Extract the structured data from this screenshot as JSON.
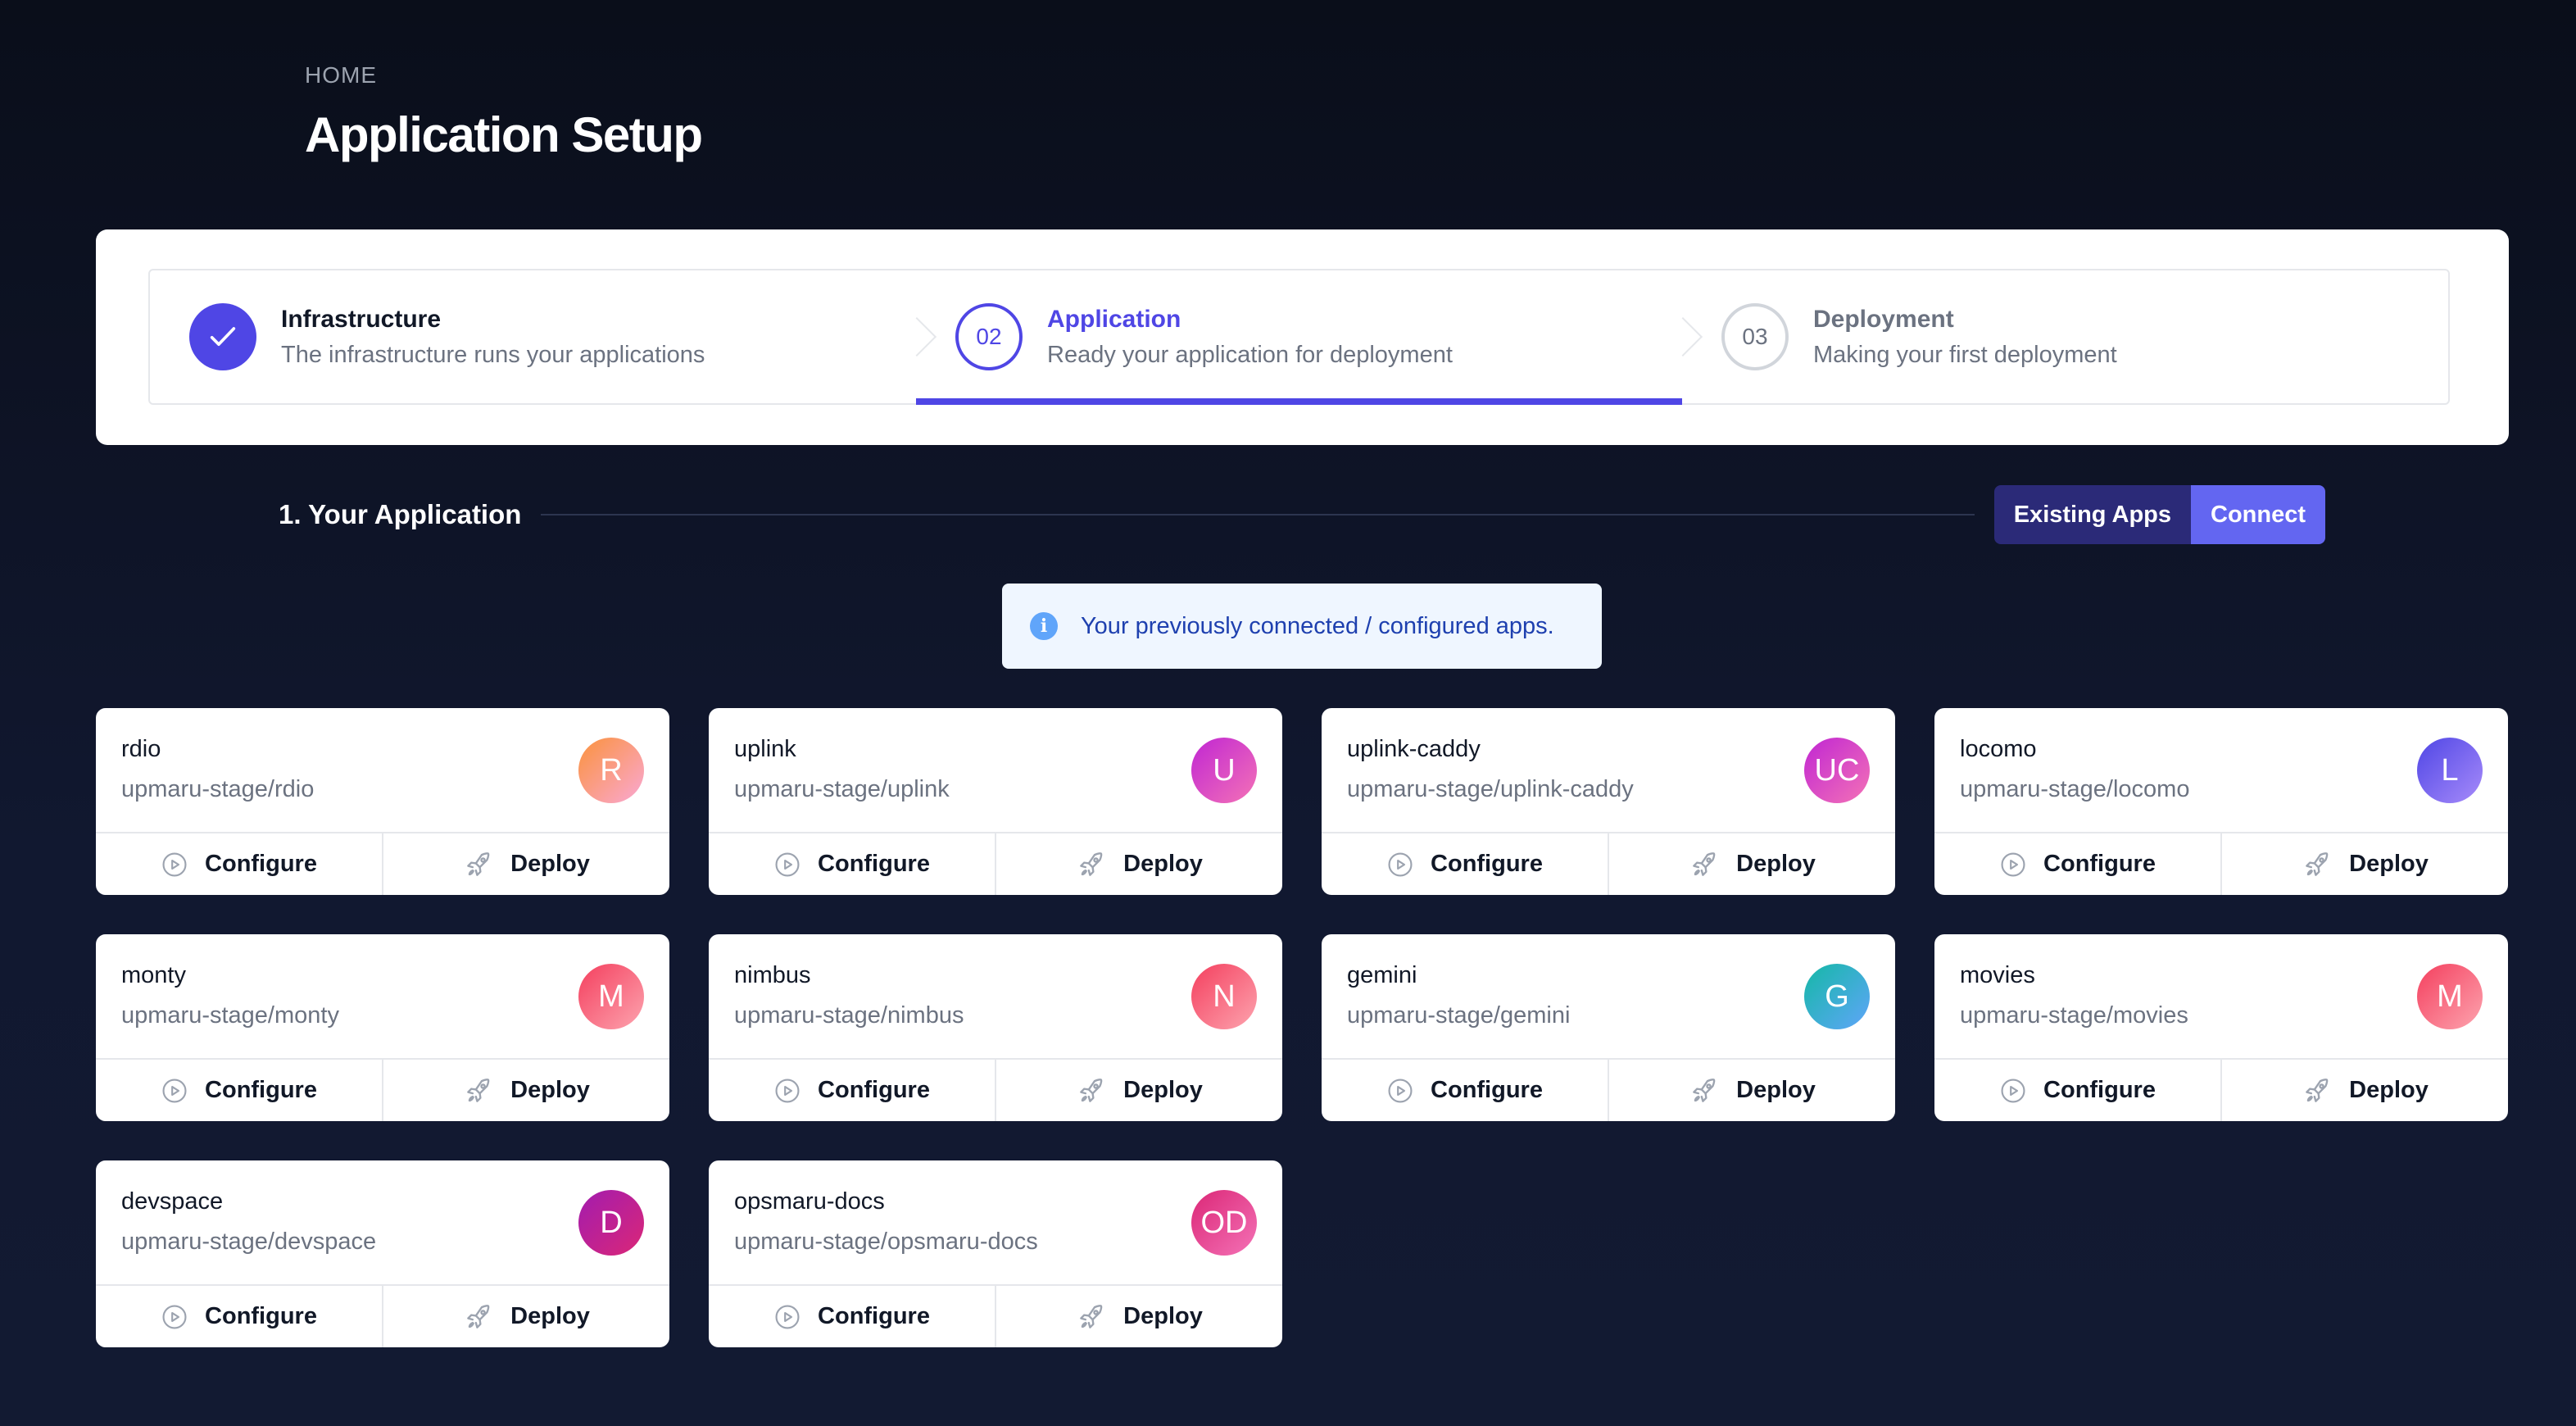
{
  "header": {
    "breadcrumb": "HOME",
    "title": "Application Setup"
  },
  "steps": [
    {
      "number": "",
      "title": "Infrastructure",
      "description": "The infrastructure runs your applications",
      "state": "complete",
      "icon": "check-icon"
    },
    {
      "number": "02",
      "title": "Application",
      "description": "Ready your application for deployment",
      "state": "current"
    },
    {
      "number": "03",
      "title": "Deployment",
      "description": "Making your first deployment",
      "state": "upcoming"
    }
  ],
  "section": {
    "title": "1. Your Application",
    "existing_label": "Existing Apps",
    "connect_label": "Connect"
  },
  "info": {
    "icon": "info-icon",
    "text": "Your previously connected / configured apps."
  },
  "actions": {
    "configure_label": "Configure",
    "deploy_label": "Deploy",
    "configure_icon": "play-circle-icon",
    "deploy_icon": "rocket-icon"
  },
  "apps": [
    {
      "name": "rdio",
      "repo": "upmaru-stage/rdio",
      "initials": "R",
      "gradient": [
        "#fb923c",
        "#f9a8d4"
      ]
    },
    {
      "name": "uplink",
      "repo": "upmaru-stage/uplink",
      "initials": "U",
      "gradient": [
        "#c026d3",
        "#f472b6"
      ]
    },
    {
      "name": "uplink-caddy",
      "repo": "upmaru-stage/uplink-caddy",
      "initials": "UC",
      "gradient": [
        "#c026d3",
        "#f472b6"
      ]
    },
    {
      "name": "locomo",
      "repo": "upmaru-stage/locomo",
      "initials": "L",
      "gradient": [
        "#4f46e5",
        "#a78bfa"
      ]
    },
    {
      "name": "monty",
      "repo": "upmaru-stage/monty",
      "initials": "M",
      "gradient": [
        "#f43f5e",
        "#fda4af"
      ]
    },
    {
      "name": "nimbus",
      "repo": "upmaru-stage/nimbus",
      "initials": "N",
      "gradient": [
        "#f43f5e",
        "#fda4af"
      ]
    },
    {
      "name": "gemini",
      "repo": "upmaru-stage/gemini",
      "initials": "G",
      "gradient": [
        "#14b8a6",
        "#60a5fa"
      ]
    },
    {
      "name": "movies",
      "repo": "upmaru-stage/movies",
      "initials": "M",
      "gradient": [
        "#f43f5e",
        "#fda4af"
      ]
    },
    {
      "name": "devspace",
      "repo": "upmaru-stage/devspace",
      "initials": "D",
      "gradient": [
        "#a21caf",
        "#db2777"
      ]
    },
    {
      "name": "opsmaru-docs",
      "repo": "upmaru-stage/opsmaru-docs",
      "initials": "OD",
      "gradient": [
        "#db2777",
        "#f472b6"
      ]
    }
  ],
  "colors": {
    "accent": "#4f46e5",
    "connect": "#6366f1",
    "existing": "#2b2a78"
  }
}
